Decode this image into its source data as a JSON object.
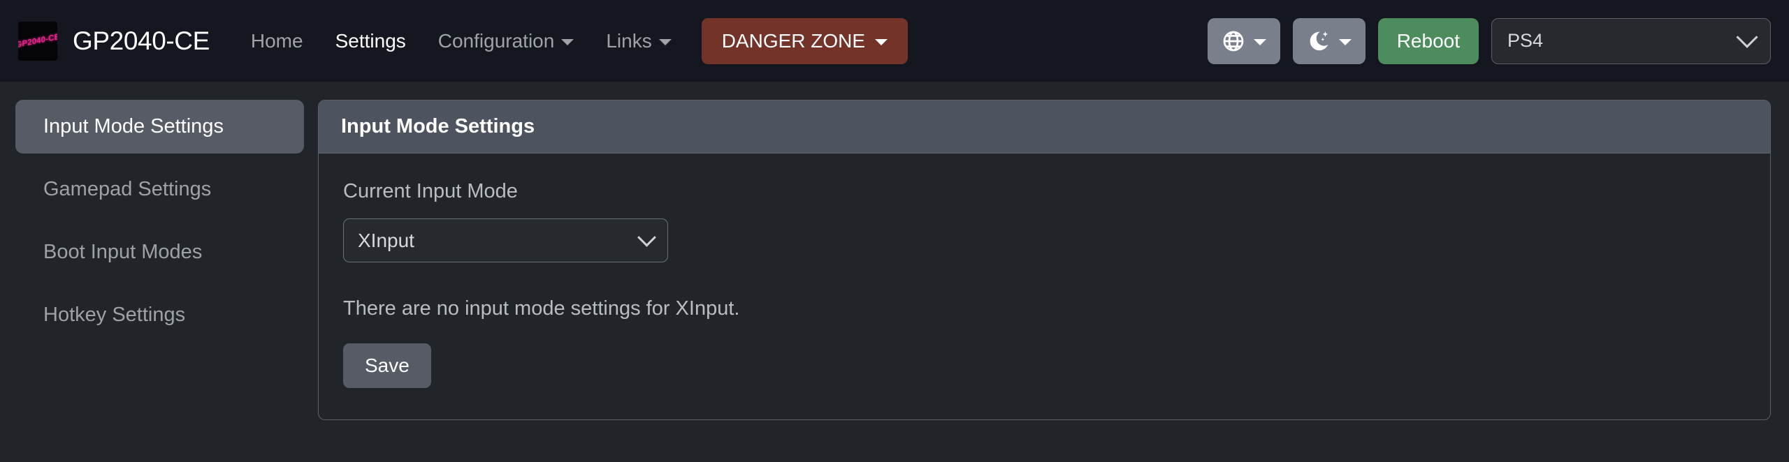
{
  "navbar": {
    "logo_text": "GP2040-CE",
    "brand": "GP2040-CE",
    "links": [
      {
        "label": "Home",
        "active": false,
        "caret": false
      },
      {
        "label": "Settings",
        "active": true,
        "caret": false
      },
      {
        "label": "Configuration",
        "active": false,
        "caret": true
      },
      {
        "label": "Links",
        "active": false,
        "caret": true
      }
    ],
    "danger_button": "DANGER ZONE",
    "language_icon": "globe-icon",
    "theme_icon": "moon-stars-icon",
    "reboot_button": "Reboot",
    "device_select": {
      "value": "PS4",
      "icon": "chevron-down-icon"
    },
    "colors": {
      "navbar_bg": "#14171f",
      "danger": "#733329",
      "reboot": "#4c8c5d",
      "logo_pink": "#ec1f8d"
    }
  },
  "sidebar": {
    "items": [
      {
        "label": "Input Mode Settings",
        "active": true
      },
      {
        "label": "Gamepad Settings",
        "active": false
      },
      {
        "label": "Boot Input Modes",
        "active": false
      },
      {
        "label": "Hotkey Settings",
        "active": false
      }
    ]
  },
  "card": {
    "header": "Input Mode Settings",
    "field_label": "Current Input Mode",
    "mode_select": {
      "value": "XInput",
      "icon": "chevron-down-icon"
    },
    "note": "There are no input mode settings for XInput.",
    "save_button": "Save"
  }
}
